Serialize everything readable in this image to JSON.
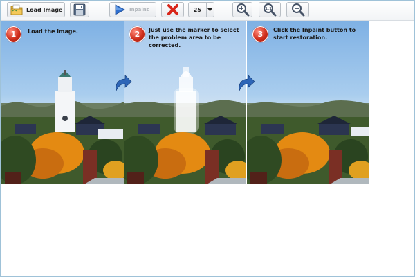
{
  "toolbar": {
    "load_label": "Load Image",
    "inpaint_label": "Inpaint",
    "brush_size": "25",
    "icons": {
      "load": "folder-icon",
      "save": "floppy-disk-icon",
      "inpaint": "play-icon",
      "clear": "red-x-icon",
      "dropdown": "chevron-down-icon",
      "zoom_in": "zoom-in-icon",
      "zoom_actual": "zoom-actual-size-icon",
      "zoom_out": "zoom-out-icon"
    },
    "zoom_actual_text": "1:1"
  },
  "steps": [
    {
      "number": "1",
      "line1": "Load the image.",
      "line2": ""
    },
    {
      "number": "2",
      "line1": "Just use the marker to select",
      "line2": "the problem area to be corrected."
    },
    {
      "number": "3",
      "line1": "Click the Inpaint button to",
      "line2": "start restoration."
    }
  ],
  "colors": {
    "frame_border": "#9fc2d8",
    "step_badge": "#d0301e",
    "arrow": "#2e66b8",
    "foliage_orange": "#e48a12"
  }
}
